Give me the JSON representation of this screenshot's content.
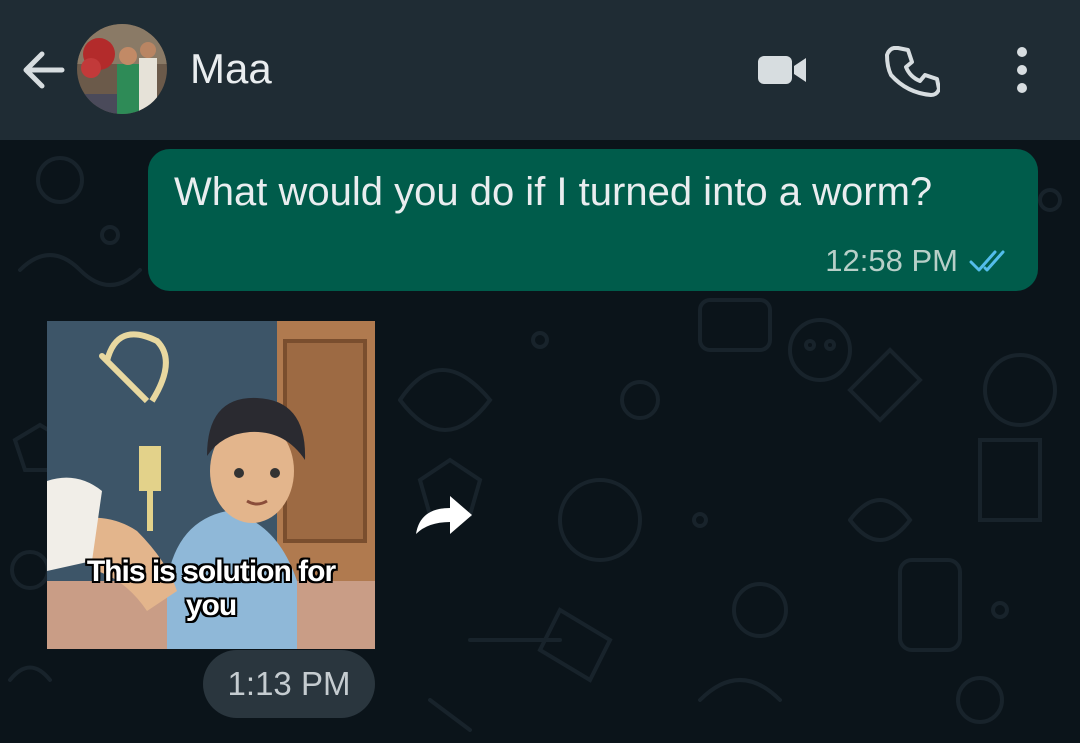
{
  "header": {
    "back_icon": "arrow-left-icon",
    "contact_name": "Maa",
    "video_icon": "video-camera-icon",
    "call_icon": "phone-icon",
    "menu_icon": "more-vertical-icon"
  },
  "messages": {
    "outgoing": {
      "text": "What would you do if I turned into a worm?",
      "time": "12:58 PM",
      "status_icon": "double-check-read-icon",
      "read_color": "#53bdeb"
    },
    "incoming_image": {
      "caption_line1": "This is solution for",
      "caption_line2": "you",
      "time": "1:13 PM",
      "forward_icon": "forward-arrow-icon"
    }
  },
  "colors": {
    "header_bg": "#1f2c34",
    "chat_bg": "#0b141a",
    "outgoing_bubble": "#005c4b",
    "time_pill": "#2a363e"
  }
}
